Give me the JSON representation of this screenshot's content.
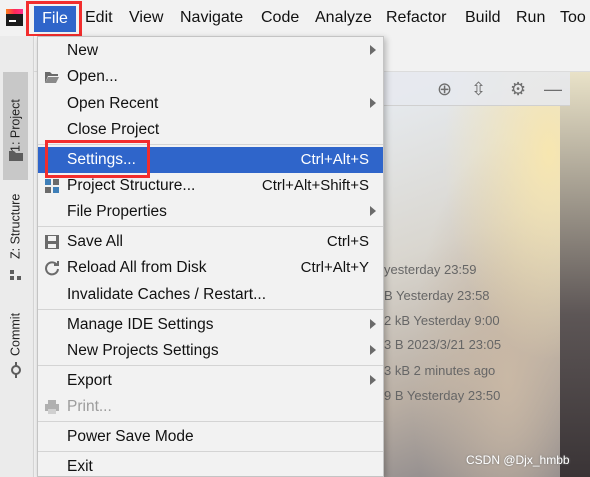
{
  "menubar": {
    "items": [
      "File",
      "Edit",
      "View",
      "Navigate",
      "Code",
      "Analyze",
      "Refactor",
      "Build",
      "Run",
      "Too"
    ]
  },
  "toolstrip": {
    "tabs": [
      "1: Project",
      "Z: Structure",
      "Commit"
    ]
  },
  "file_menu": {
    "items": [
      {
        "label": "New",
        "submenu": true
      },
      {
        "label": "Open...",
        "icon": "folder-open-icon"
      },
      {
        "label": "Open Recent",
        "submenu": true
      },
      {
        "label": "Close Project"
      },
      {
        "label": "Settings...",
        "shortcut": "Ctrl+Alt+S",
        "selected": true
      },
      {
        "label": "Project Structure...",
        "shortcut": "Ctrl+Alt+Shift+S",
        "icon": "project-structure-icon"
      },
      {
        "label": "File Properties",
        "submenu": true
      },
      {
        "label": "Save All",
        "shortcut": "Ctrl+S",
        "icon": "save-icon"
      },
      {
        "label": "Reload All from Disk",
        "shortcut": "Ctrl+Alt+Y",
        "icon": "reload-icon"
      },
      {
        "label": "Invalidate Caches / Restart..."
      },
      {
        "label": "Manage IDE Settings",
        "submenu": true
      },
      {
        "label": "New Projects Settings",
        "submenu": true
      },
      {
        "label": "Export",
        "submenu": true
      },
      {
        "label": "Print...",
        "disabled": true,
        "icon": "print-icon"
      },
      {
        "label": "Power Save Mode"
      },
      {
        "label": "Exit"
      }
    ]
  },
  "background_files": [
    "yesterday 23:59",
    "B Yesterday 23:58",
    "2 kB Yesterday 9:00",
    "3 B 2023/3/21 23:05",
    "3 kB 2 minutes ago",
    "9 B Yesterday 23:50"
  ],
  "watermark": "CSDN @Djx_hmbb",
  "colors": {
    "accent": "#2f65ca",
    "highlight_border": "#f22d2d"
  }
}
